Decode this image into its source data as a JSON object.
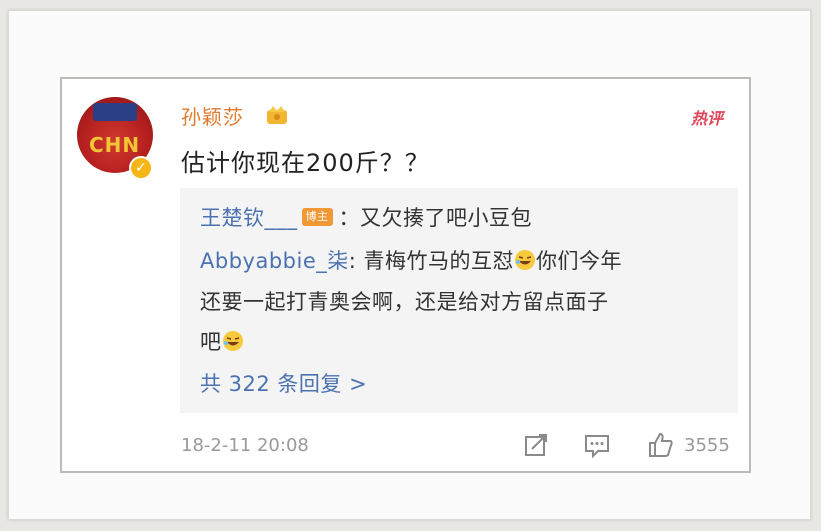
{
  "post": {
    "username": "孙颖莎",
    "text": "估计你现在200斤？？",
    "hot_label": "热评",
    "avatar_text": "CHN",
    "timestamp": "18-2-11 20:08",
    "likes": "3555"
  },
  "replies": [
    {
      "author": "王楚钦___",
      "badge": "博主",
      "text": "：又欠揍了吧小豆包"
    },
    {
      "author": "Abbyabbie_柒",
      "text_line1": ": 青梅竹马的互怼",
      "text_line1b": "你们今年",
      "text_line2": "还要一起打青奥会啊，还是给对方留点面子",
      "text_line3": "吧"
    }
  ],
  "more_replies": "共 322 条回复 >",
  "icons": {
    "share": "share-icon",
    "comment": "comment-icon",
    "like": "thumbs-up-icon",
    "crown": "crown-icon",
    "verified": "verified-icon",
    "emoji": "laughing-emoji-icon"
  },
  "colors": {
    "username": "#e07a2d",
    "link": "#4b72b0",
    "hot": "#e0475a",
    "verified": "#f6b618"
  }
}
